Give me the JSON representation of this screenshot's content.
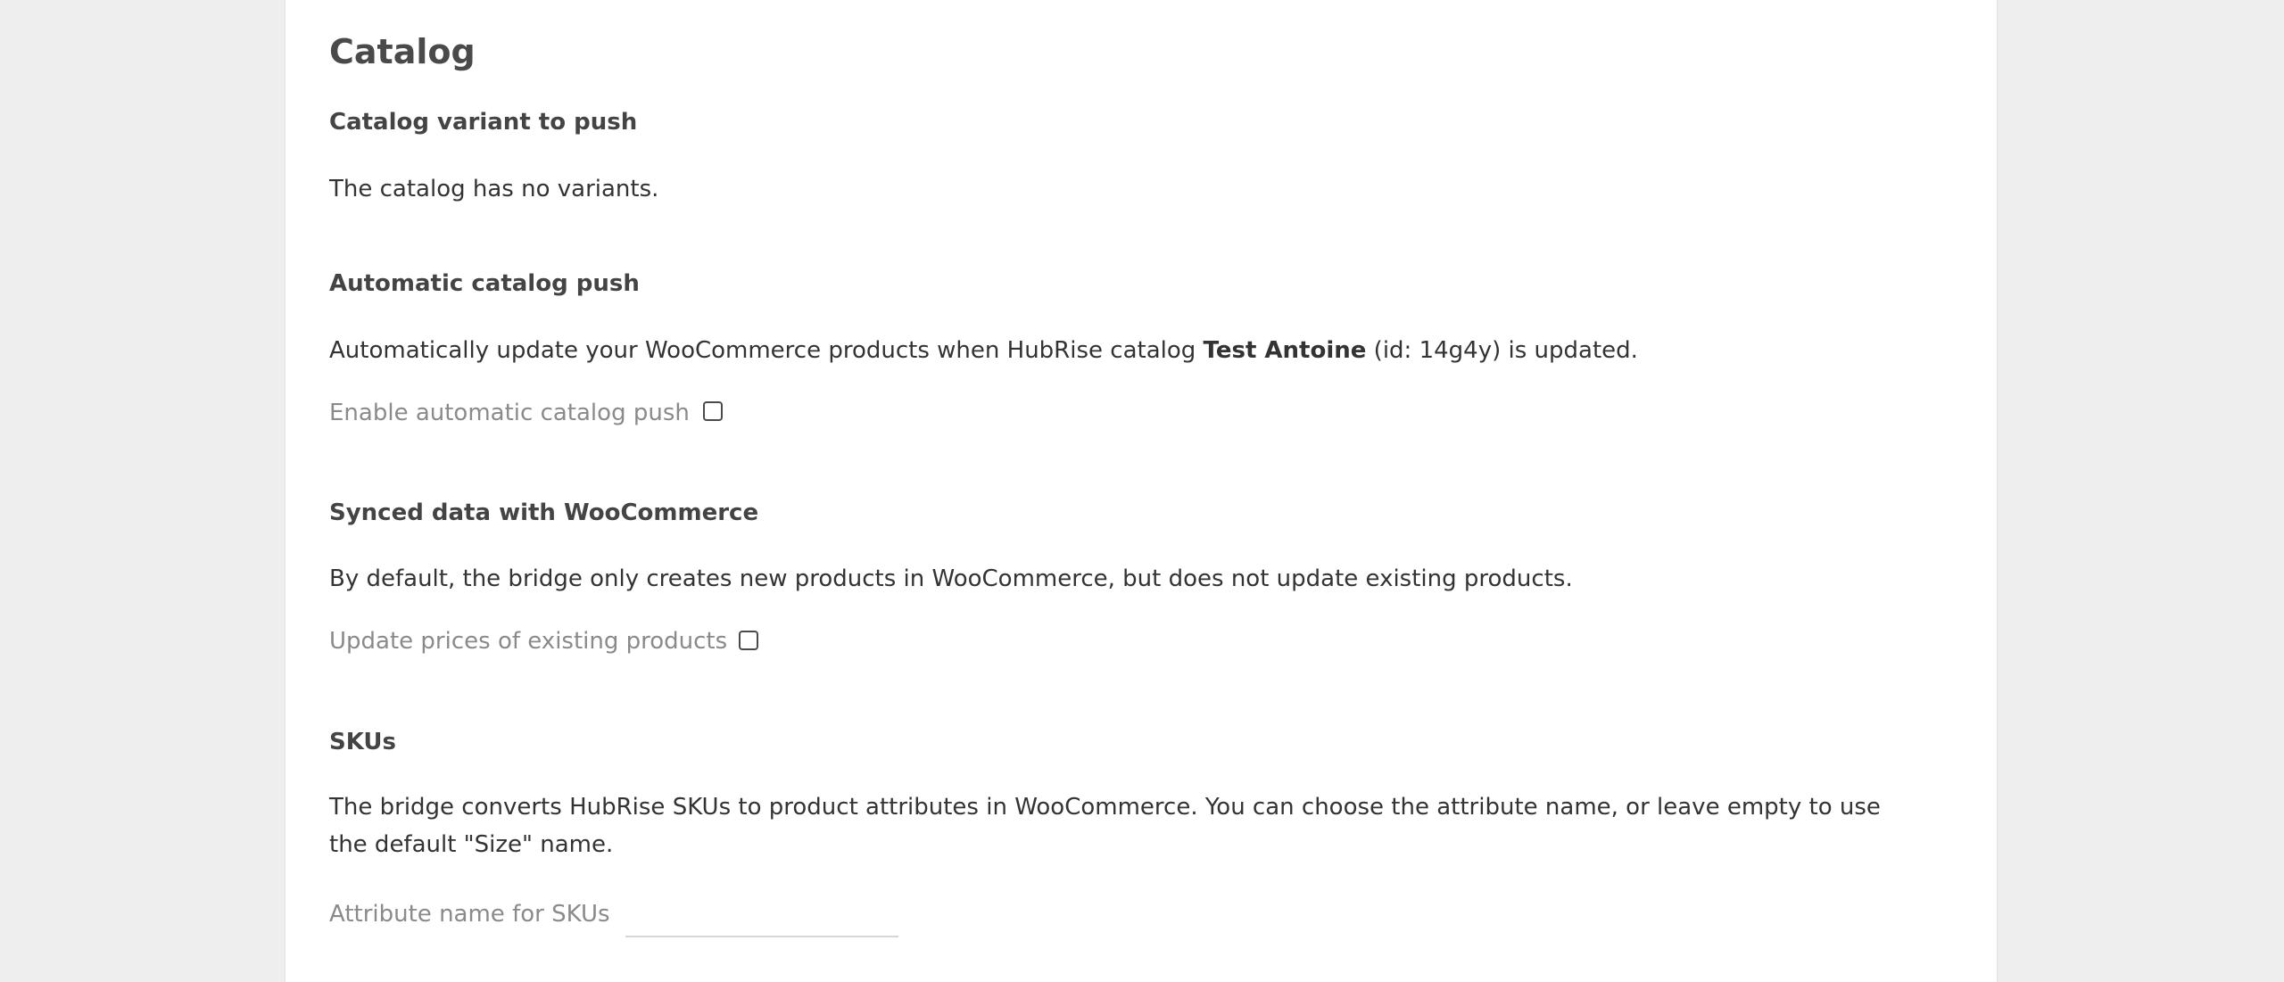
{
  "page": {
    "title": "Catalog"
  },
  "sections": {
    "variant": {
      "title": "Catalog variant to push",
      "description": "The catalog has no variants."
    },
    "auto_push": {
      "title": "Automatic catalog push",
      "description_before": "Automatically update your WooCommerce products when HubRise catalog ",
      "catalog_name": "Test Antoine",
      "description_after": " (id: 14g4y) is updated.",
      "checkbox_label": "Enable automatic catalog push",
      "checkbox_checked": false
    },
    "synced_data": {
      "title": "Synced data with WooCommerce",
      "description": "By default, the bridge only creates new products in WooCommerce, but does not update existing products.",
      "checkbox_label": "Update prices of existing products",
      "checkbox_checked": false
    },
    "skus": {
      "title": "SKUs",
      "description": "The bridge converts HubRise SKUs to product attributes in WooCommerce. You can choose the attribute name, or leave empty to use the default \"Size\" name.",
      "input_label": "Attribute name for SKUs",
      "input_value": ""
    }
  }
}
